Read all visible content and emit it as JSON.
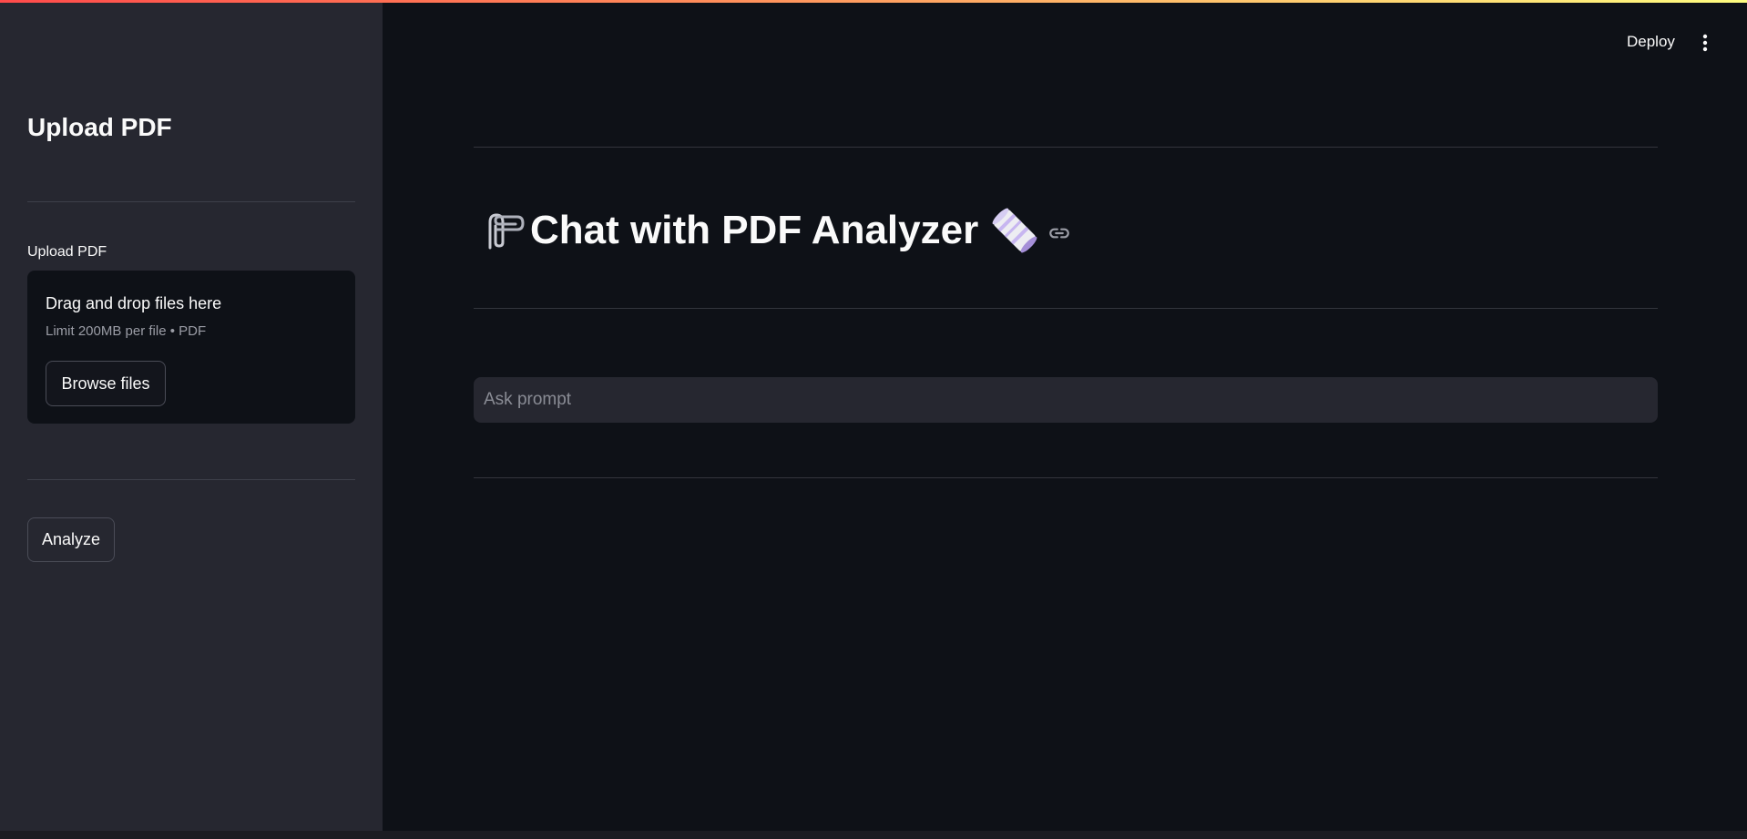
{
  "header": {
    "deploy_label": "Deploy",
    "menu_icon": "more-vertical-icon"
  },
  "sidebar": {
    "title": "Upload PDF",
    "uploader": {
      "label": "Upload PDF",
      "drop_text": "Drag and drop files here",
      "limit_text": "Limit 200MB per file • PDF",
      "browse_label": "Browse files"
    },
    "analyze_label": "Analyze"
  },
  "main": {
    "title": "Chat with PDF Analyzer",
    "title_leading_emoji": "paperclips-icon",
    "title_trailing_emoji": "roll-of-paper-icon",
    "anchor_icon": "link-icon",
    "prompt": {
      "placeholder": "Ask prompt",
      "value": ""
    }
  },
  "colors": {
    "app_background": "#0e1117",
    "sidebar_background": "#262730",
    "text": "#fafafa",
    "muted_text": "#9b9da6",
    "accent_gradient_start": "#ff4b4b",
    "accent_gradient_end": "#fffd80"
  }
}
